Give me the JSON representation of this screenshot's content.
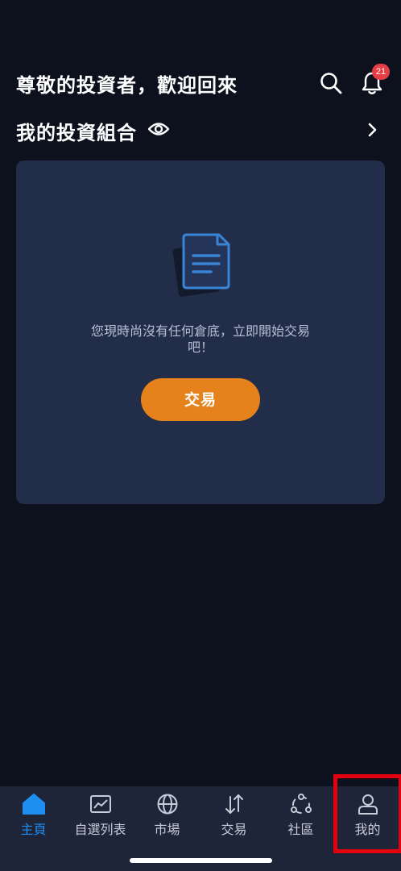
{
  "header": {
    "greeting": "尊敬的投資者，歡迎回來",
    "notification_count": "21"
  },
  "portfolio": {
    "title": "我的投資組合"
  },
  "empty_state": {
    "message": "您現時尚沒有任何倉底，立即開始交易吧！",
    "cta_label": "交易"
  },
  "tabs": [
    {
      "label": "主頁",
      "icon": "home-icon",
      "active": true
    },
    {
      "label": "自選列表",
      "icon": "chart-icon",
      "active": false
    },
    {
      "label": "市場",
      "icon": "globe-icon",
      "active": false
    },
    {
      "label": "交易",
      "icon": "swap-arrows-icon",
      "active": false
    },
    {
      "label": "社區",
      "icon": "community-icon",
      "active": false
    },
    {
      "label": "我的",
      "icon": "person-icon",
      "active": false
    }
  ],
  "colors": {
    "background": "#0d111d",
    "card": "#222d4a",
    "accent_orange": "#e5821b",
    "active_tab": "#1f8ef1",
    "badge": "#e53f45",
    "highlight": "#e3000f"
  }
}
